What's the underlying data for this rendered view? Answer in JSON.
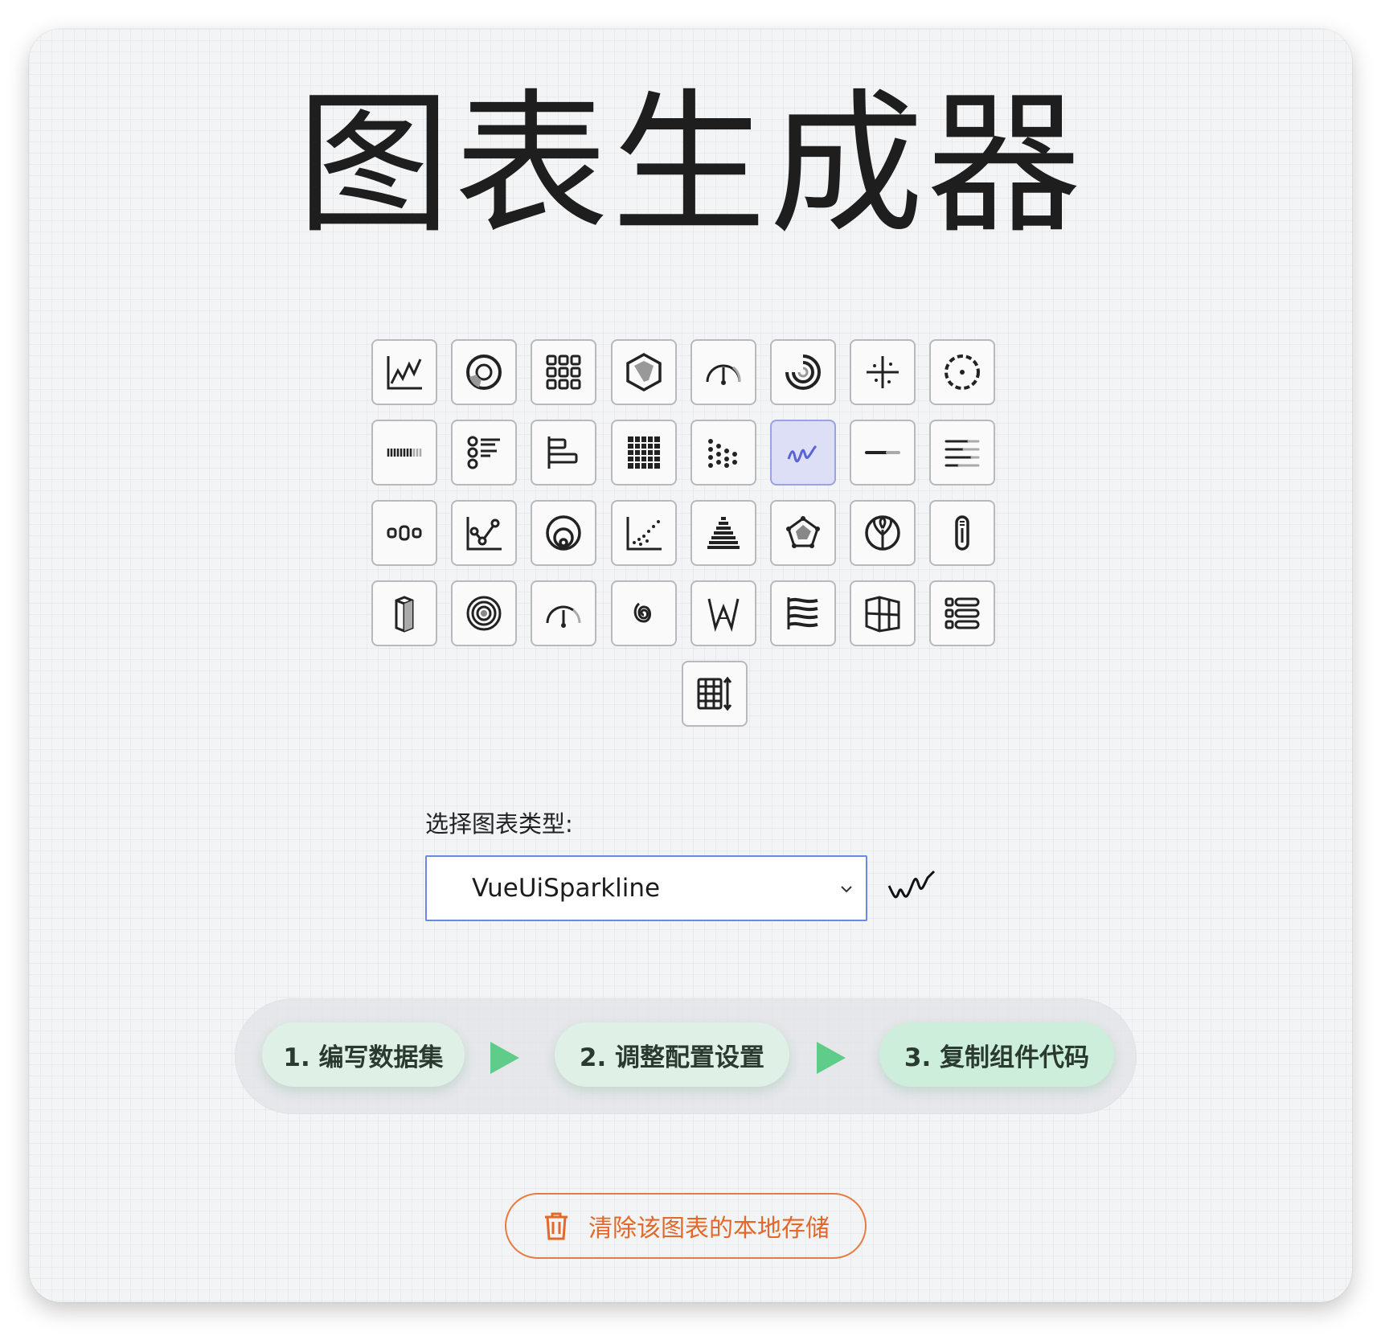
{
  "page": {
    "title": "图表生成器"
  },
  "chart_icons": [
    {
      "name": "line-chart-icon"
    },
    {
      "name": "donut-chart-icon"
    },
    {
      "name": "waffle-chart-icon"
    },
    {
      "name": "radar-hexagon-icon"
    },
    {
      "name": "gauge-icon"
    },
    {
      "name": "rings-icon"
    },
    {
      "name": "quadrant-icon"
    },
    {
      "name": "dashed-ring-icon"
    },
    {
      "name": "sparkbar-icon"
    },
    {
      "name": "stacked-list-icon"
    },
    {
      "name": "horizontal-bar-icon"
    },
    {
      "name": "heatmap-grid-icon"
    },
    {
      "name": "scatter-dots-icon"
    },
    {
      "name": "sparkline-icon"
    },
    {
      "name": "progress-line-icon"
    },
    {
      "name": "text-lines-icon"
    },
    {
      "name": "dots-row-icon"
    },
    {
      "name": "network-chart-icon"
    },
    {
      "name": "nested-circles-icon"
    },
    {
      "name": "dotted-trend-icon"
    },
    {
      "name": "pyramid-icon"
    },
    {
      "name": "pentagon-radar-icon"
    },
    {
      "name": "leaf-circle-icon"
    },
    {
      "name": "thermometer-icon"
    },
    {
      "name": "3d-bar-icon"
    },
    {
      "name": "target-circles-icon"
    },
    {
      "name": "half-gauge-icon"
    },
    {
      "name": "spiral-icon"
    },
    {
      "name": "wheel-word-icon"
    },
    {
      "name": "waves-flag-icon"
    },
    {
      "name": "cube-frame-icon"
    },
    {
      "name": "list-table-icon"
    },
    {
      "name": "table-sort-icon"
    }
  ],
  "selected_index": 13,
  "selector": {
    "label": "选择图表类型:",
    "value": "VueUiSparkline"
  },
  "steps": [
    {
      "label": "1. 编写数据集"
    },
    {
      "label": "2. 调整配置设置"
    },
    {
      "label": "3. 复制组件代码"
    }
  ],
  "clear_button": {
    "label": "清除该图表的本地存储"
  },
  "colors": {
    "accent_selected": "#dcdff5",
    "step_green": "#dff1e6",
    "arrow_green": "#5fcc8a",
    "clear_orange": "#e2692a",
    "select_border": "#6b87e8"
  }
}
